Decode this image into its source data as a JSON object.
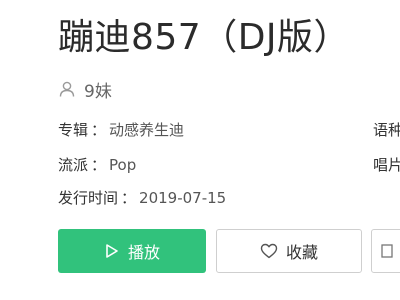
{
  "song": {
    "title": "蹦迪857（DJ版）",
    "artist": "9妹",
    "album_label": "专辑",
    "album_value": "动感养生迪",
    "genre_label": "流派",
    "genre_value": "Pop",
    "release_label": "发行时间",
    "release_value": "2019-07-15",
    "language_label_partial": "语种",
    "label_label_partial": "唱片"
  },
  "actions": {
    "play_label": "播放",
    "favorite_label": "收藏"
  },
  "colors": {
    "accent": "#31c27c",
    "text": "#333333",
    "muted": "#666666",
    "border": "#cfcfcf"
  },
  "icons": {
    "artist": "user-icon",
    "play": "play-icon",
    "favorite": "heart-icon",
    "more": "more-icon"
  }
}
